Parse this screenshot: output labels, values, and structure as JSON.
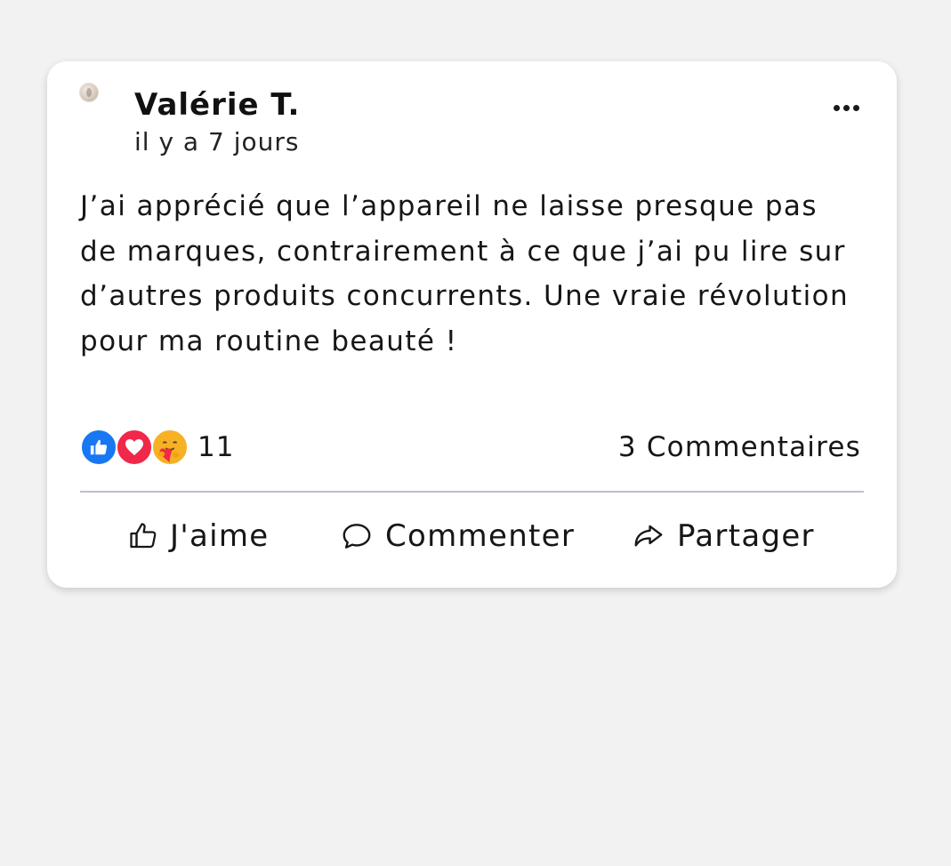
{
  "post": {
    "author": "Valérie T.",
    "time": "il y a 7 jours",
    "body": "J’ai apprécié que l’appareil ne laisse presque pas de marques, contrairement à ce que j’ai pu lire sur d’autres produits concurrents. Une vraie révolution pour ma routine beauté !",
    "more_icon": "ellipsis-icon"
  },
  "reactions": {
    "icons": [
      "like-reaction-icon",
      "love-reaction-icon",
      "care-reaction-icon"
    ],
    "count": "11",
    "colors": {
      "like": "#1877f2",
      "love": "#f0284a",
      "care": "#f7b125"
    }
  },
  "comments": {
    "count_label": "3 Commentaires"
  },
  "actions": {
    "like_label": "J'aime",
    "comment_label": "Commenter",
    "share_label": "Partager"
  }
}
